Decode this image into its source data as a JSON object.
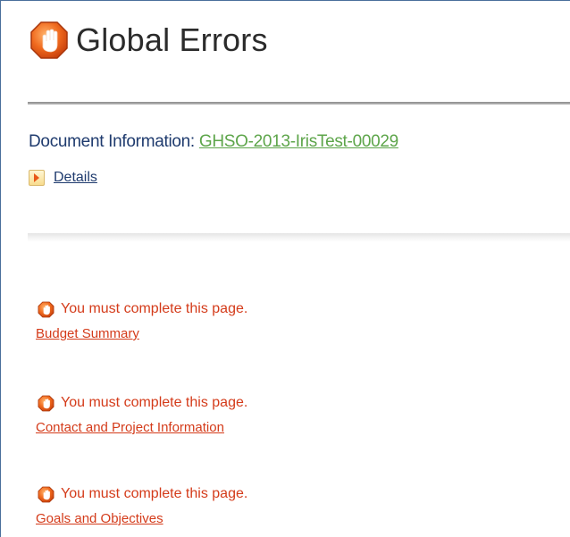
{
  "header": {
    "title": "Global Errors",
    "icon": "stop-hand-icon"
  },
  "document": {
    "label": "Document Information:",
    "id": "GHSO-2013-IrisTest-00029",
    "details_label": "Details"
  },
  "errors": [
    {
      "message": "You must complete this page.",
      "link": "Budget Summary"
    },
    {
      "message": "You must complete this page.",
      "link": "Contact and Project Information"
    },
    {
      "message": "You must complete this page.",
      "link": "Goals and Objectives"
    }
  ],
  "colors": {
    "error_red": "#d43b1a",
    "link_green": "#5da54a",
    "text_navy": "#1f3b6e",
    "icon_orange": "#e8591a"
  }
}
